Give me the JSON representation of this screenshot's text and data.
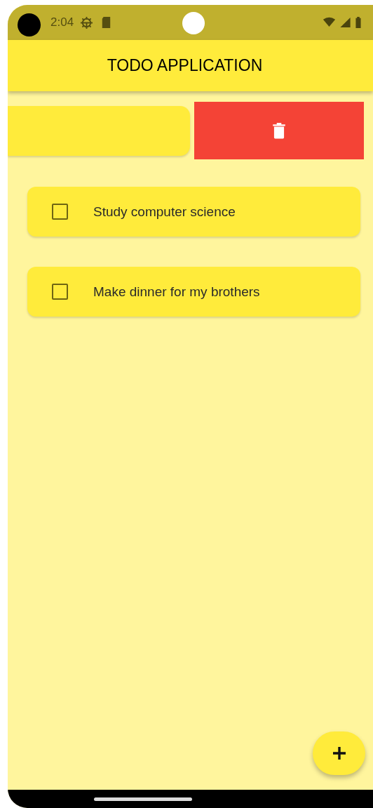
{
  "status_bar": {
    "time": "2:04"
  },
  "app_bar": {
    "title": "TODO APPLICATION"
  },
  "todos": [
    {
      "kind": "swiped"
    },
    {
      "kind": "item",
      "text": "Study computer science",
      "checked": false
    },
    {
      "kind": "item",
      "text": "Make dinner for my brothers",
      "checked": false
    }
  ]
}
